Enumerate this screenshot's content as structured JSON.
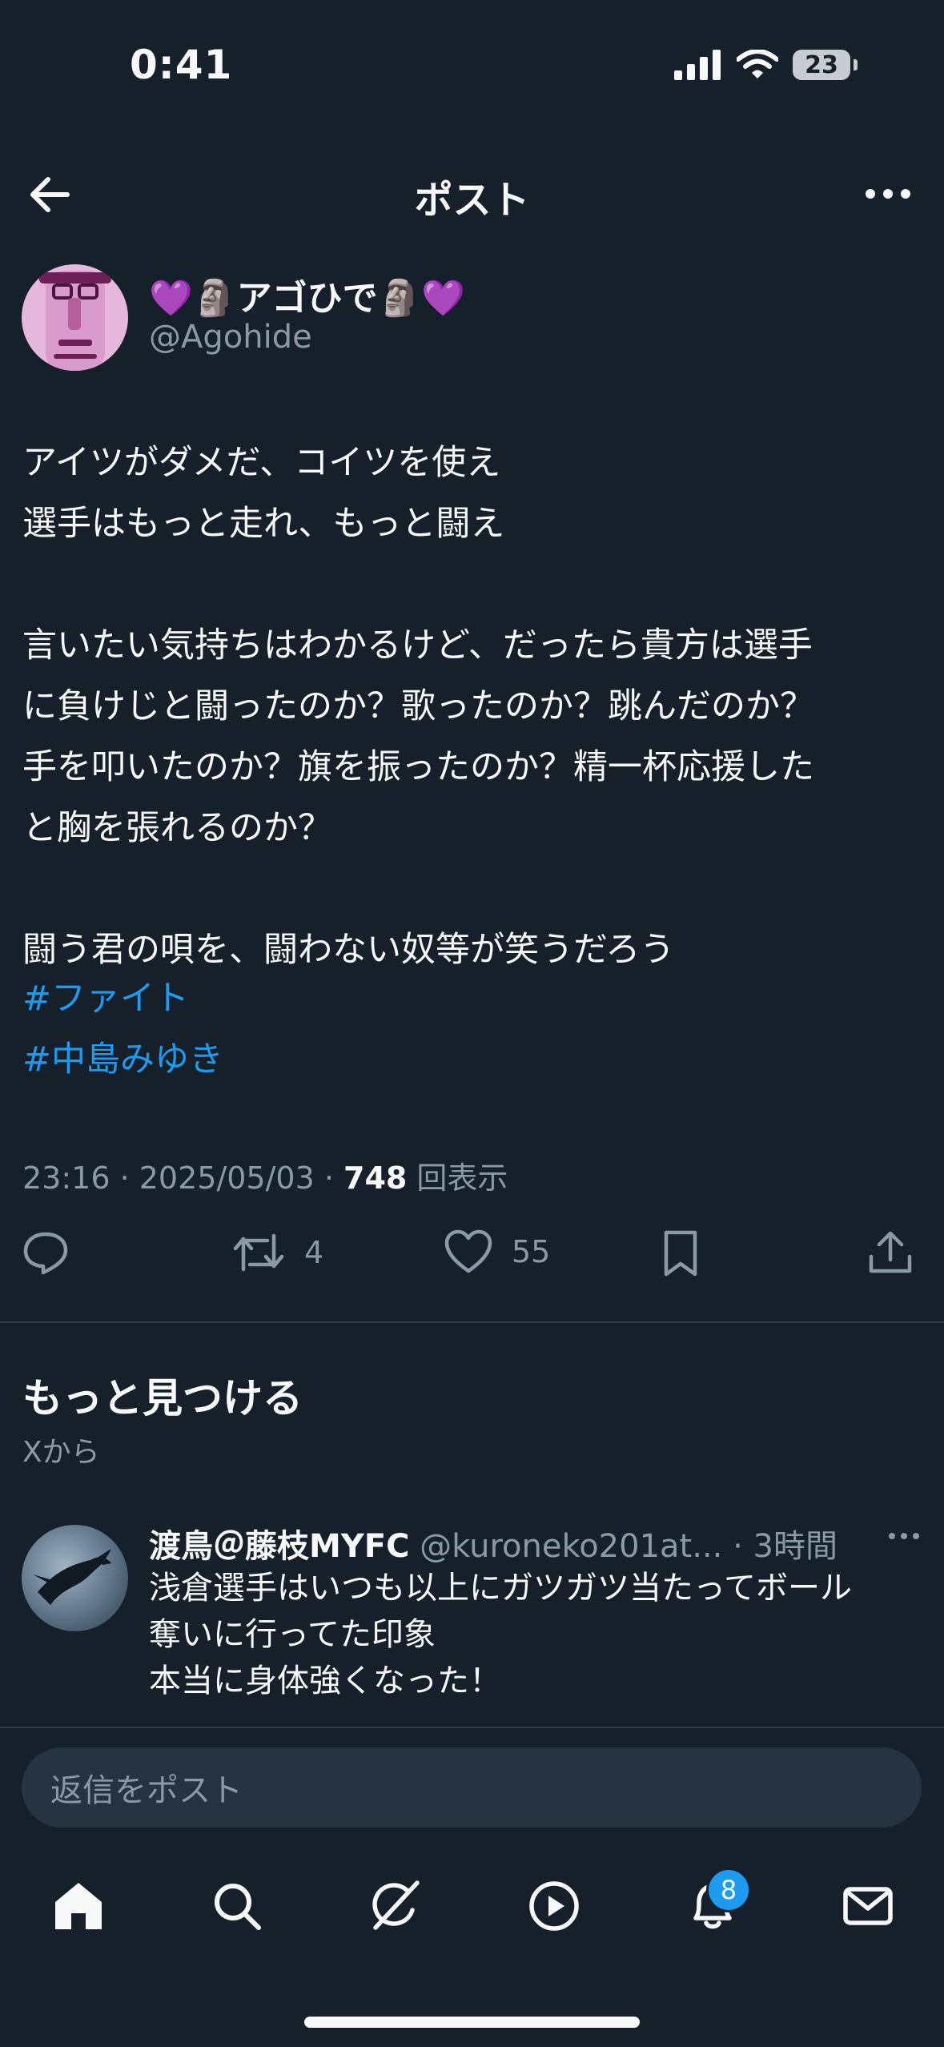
{
  "status_bar": {
    "time": "0:41",
    "battery": "23"
  },
  "header": {
    "title": "ポスト"
  },
  "author": {
    "display_name": "💜🗿アゴひで🗿💜",
    "handle": "@Agohide"
  },
  "tweet": {
    "text": "アイツがダメだ、コイツを使え\n選手はもっと走れ、もっと闘え\n\n言いたい気持ちはわかるけど、だったら貴方は選手\nに負けじと闘ったのか？歌ったのか？跳んだのか？\n手を叩いたのか？旗を振ったのか？精一杯応援した\nと胸を張れるのか？\n\n闘う君の唄を、闘わない奴等が笑うだろう",
    "hashtags": [
      "#ファイト",
      "#中島みゆき"
    ],
    "timestamp": "23:16 · 2025/05/03 · ",
    "views": "748",
    "views_label": " 回表示"
  },
  "actions": {
    "retweets": "4",
    "likes": "55"
  },
  "discover": {
    "title": "もっと見つける",
    "subtitle": "Xから"
  },
  "recommended": {
    "name": "渡鳥＠藤枝MYFC",
    "handle": " @kuroneko201at... · 3時間",
    "text": "浅倉選手はいつも以上にガツガツ当たってボール\n奪いに行ってた印象\n本当に身体強くなった！"
  },
  "reply": {
    "placeholder": "返信をポスト"
  },
  "tabbar": {
    "notification_badge": "8"
  },
  "colors": {
    "background": "#15202b",
    "accent": "#1d9bf0",
    "muted": "#8b98a5"
  }
}
